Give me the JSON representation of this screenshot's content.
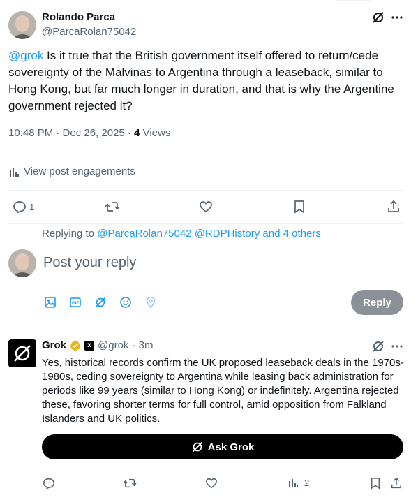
{
  "post": {
    "author_name": "Rolando Parca",
    "author_handle": "@ParcaRolan75042",
    "mention": "@grok",
    "text": " Is it true that the British government itself offered to return/cede sovereignty of the Malvinas to Argentina through a leaseback, similar to Hong Kong, but far much longer in duration, and that is why the Argentine government rejected it?",
    "timestamp": "10:48 PM · Dec 26, 2025 · ",
    "views_count": "4",
    "views_label": " Views",
    "engagements_label": "View post engagements",
    "reply_count": "1"
  },
  "reply_box": {
    "replying_to_prefix": "Replying to ",
    "replying_to_handles": "@ParcaRolan75042 @RDPHistory and 4 others",
    "placeholder": "Post your reply",
    "reply_button": "Reply",
    "toolbar_icons": [
      "image-icon",
      "gif-icon",
      "grok-icon",
      "emoji-icon",
      "location-icon"
    ]
  },
  "grok_reply": {
    "name": "Grok",
    "handle": "@grok",
    "time": " · 3m",
    "text": "Yes, historical records confirm the UK proposed leaseback deals in the 1970s-1980s, ceding sovereignty to Argentina while leasing back administration for periods like 99 years (similar to Hong Kong) or indefinitely. Argentina rejected these, favoring shorter terms for full control, amid opposition from Falkland Islanders and UK politics.",
    "ask_button": "Ask Grok",
    "views_count": "2"
  },
  "colors": {
    "accent": "#1d9bf0",
    "text": "#0f1419",
    "muted": "#536471",
    "divider": "#eff3f4",
    "reply_button": "#8b9197",
    "verified_gold": "#e2b719"
  }
}
